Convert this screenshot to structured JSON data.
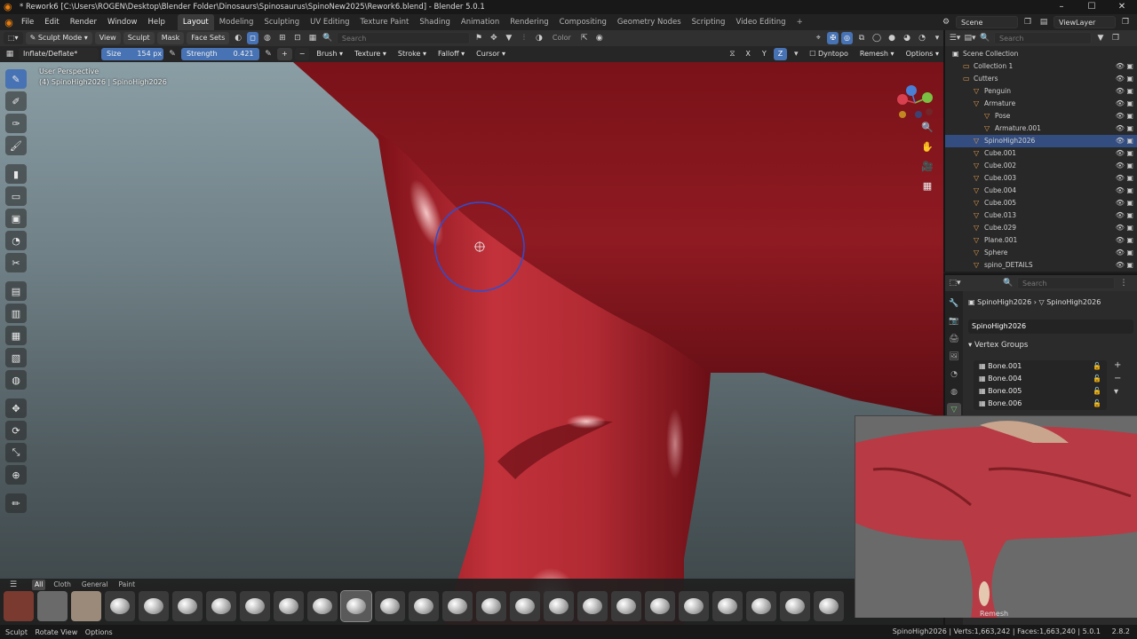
{
  "window": {
    "title": "* Rework6 [C:\\Users\\ROGEN\\Desktop\\Blender Folder\\Dinosaurs\\Spinosaurus\\SpinoNew2025\\Rework6.blend] - Blender 5.0.1"
  },
  "menu": [
    "File",
    "Edit",
    "Render",
    "Window",
    "Help"
  ],
  "workspaces": [
    "Layout",
    "Modeling",
    "Sculpting",
    "UV Editing",
    "Texture Paint",
    "Shading",
    "Animation",
    "Rendering",
    "Compositing",
    "Geometry Nodes",
    "Scripting",
    "Video Editing"
  ],
  "workspace_plus": "+",
  "active_workspace": "Layout",
  "scene": "Scene",
  "view_layer": "ViewLayer",
  "viewport_header": {
    "mode": "Sculpt Mode",
    "menus": [
      "View",
      "Sculpt",
      "Mask",
      "Face Sets"
    ],
    "search_placeholder": "Search",
    "color_label": "Color"
  },
  "tool_settings": {
    "brush_name": "Inflate/Deflate*",
    "size_label": "Size",
    "size_value": "154 px",
    "strength_label": "Strength",
    "strength_value": "0.421",
    "menus": [
      "Brush",
      "Texture",
      "Stroke",
      "Falloff",
      "Cursor"
    ],
    "axes": [
      "X",
      "Y",
      "Z"
    ],
    "dyntopo": "Dyntopo",
    "remesh": "Remesh",
    "options": "Options"
  },
  "viewport": {
    "perspective": "User Perspective",
    "object_info": "(4) SpinoHigh2026 | SpinoHigh2026"
  },
  "brush_tabs": [
    "All",
    "Cloth",
    "General",
    "Paint"
  ],
  "active_brush_tab": "All",
  "outliner": {
    "search_placeholder": "Search",
    "root": "Scene Collection",
    "rows": [
      {
        "name": "Collection 1",
        "depth": 1
      },
      {
        "name": "Cutters",
        "depth": 1
      },
      {
        "name": "Penguin",
        "depth": 2
      },
      {
        "name": "Armature",
        "depth": 2
      },
      {
        "name": "Pose",
        "depth": 3
      },
      {
        "name": "Armature.001",
        "depth": 3
      },
      {
        "name": "SpinoHigh2026",
        "depth": 2,
        "selected": true
      },
      {
        "name": "Cube.001",
        "depth": 2
      },
      {
        "name": "Cube.002",
        "depth": 2
      },
      {
        "name": "Cube.003",
        "depth": 2
      },
      {
        "name": "Cube.004",
        "depth": 2
      },
      {
        "name": "Cube.005",
        "depth": 2
      },
      {
        "name": "Cube.013",
        "depth": 2
      },
      {
        "name": "Cube.029",
        "depth": 2
      },
      {
        "name": "Plane.001",
        "depth": 2
      },
      {
        "name": "Sphere",
        "depth": 2
      },
      {
        "name": "spino_DETAILS",
        "depth": 2
      }
    ]
  },
  "properties": {
    "search_placeholder": "Search",
    "breadcrumb_object": "SpinoHigh2026",
    "breadcrumb_mesh": "SpinoHigh2026",
    "mesh_name": "SpinoHigh2026",
    "panel": "Vertex Groups",
    "vertex_groups": [
      "Bone.001",
      "Bone.004",
      "Bone.005",
      "Bone.006"
    ]
  },
  "reference_label": "Remesh",
  "statusbar": {
    "left": [
      "Sculpt",
      "Rotate View",
      "Options"
    ],
    "stats": "SpinoHigh2026 | Verts:1,663,242 | Faces:1,663,240 | 5.0.1",
    "version": "2.8.2"
  },
  "colors": {
    "accent": "#4772b3",
    "mesh": "#b3242e",
    "selected_row": "#334d80"
  }
}
